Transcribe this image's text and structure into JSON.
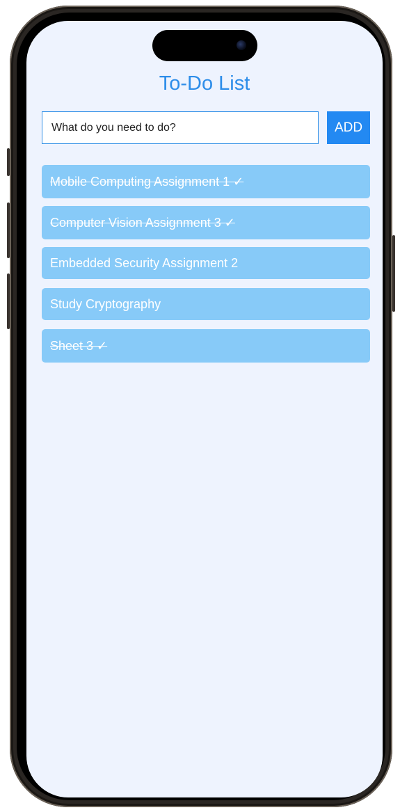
{
  "app": {
    "title": "To-Do List"
  },
  "form": {
    "input_value": "",
    "input_placeholder": "What do you need to do?",
    "add_label": "ADD"
  },
  "todos": [
    {
      "text": "Mobile Computing Assignment 1 ✓",
      "done": true
    },
    {
      "text": "Computer Vision Assignment 3 ✓",
      "done": true
    },
    {
      "text": "Embedded Security Assignment 2",
      "done": false
    },
    {
      "text": "Study Cryptography",
      "done": false
    },
    {
      "text": "Sheet 3 ✓",
      "done": true
    }
  ],
  "colors": {
    "accent": "#2389f2",
    "title": "#2d8de9",
    "item_bg": "#87caf8",
    "screen_bg": "#eef3fe"
  }
}
